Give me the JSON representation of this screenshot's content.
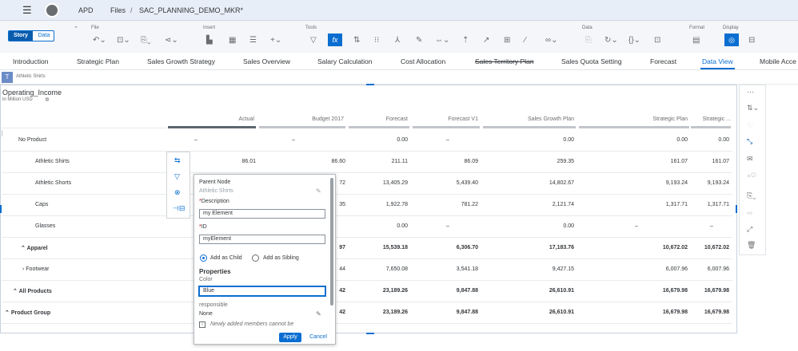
{
  "shell": {
    "menu_icon": "hamburger-icon",
    "app": "APD",
    "breadcrumb_root": "Files",
    "breadcrumb_sep": "/",
    "file_name": "SAC_PLANNING_DEMO_MKR*"
  },
  "toolbar": {
    "modes": [
      "Story",
      "Data"
    ],
    "active_mode": "Story",
    "groups": {
      "file": "File",
      "insert": "Insert",
      "tools": "Tools",
      "data": "Data",
      "format": "Format",
      "display": "Display"
    }
  },
  "tabs": [
    {
      "label": "Introduction"
    },
    {
      "label": "Strategic Plan"
    },
    {
      "label": "Sales Growth Strategy"
    },
    {
      "label": "Sales Overview"
    },
    {
      "label": "Salary Calculation"
    },
    {
      "label": "Cost Allocation"
    },
    {
      "label": "Sales Territory Plan"
    },
    {
      "label": "Sales Quota Setting"
    },
    {
      "label": "Forecast"
    },
    {
      "label": "Data View"
    },
    {
      "label": "Mobile Acce"
    }
  ],
  "filter_chip": {
    "icon": "T",
    "label": "Athletic Shirts"
  },
  "table": {
    "title": "Operating_Income",
    "subtitle": "in Million USD",
    "columns": [
      "Actual",
      "Budget 2017",
      "Forecast",
      "Forecast V1",
      "Sales Growth Plan",
      "Strategic Plan",
      "Strategic ..."
    ],
    "rows": [
      {
        "label": "No Product",
        "values": [
          "–",
          "–",
          "0.00",
          "–",
          "0.00",
          "0.00",
          "0.00"
        ]
      },
      {
        "label": "Athletic Shirts",
        "values": [
          "86.01",
          "86.60",
          "211.11",
          "86.09",
          "259.35",
          "161.07",
          "161.07"
        ]
      },
      {
        "label": "Athletic Shorts",
        "values": [
          "",
          "72",
          "13,405.29",
          "5,439.40",
          "14,802.67",
          "9,193.24",
          "9,193.24"
        ]
      },
      {
        "label": "Caps",
        "values": [
          "",
          "35",
          "1,922.78",
          "781.22",
          "2,121.74",
          "1,317.71",
          "1,317.71"
        ]
      },
      {
        "label": "Glasses",
        "values": [
          "",
          "",
          "0.00",
          "–",
          "0.00",
          "–",
          "–"
        ]
      },
      {
        "label": "Apparel",
        "values": [
          "",
          "97",
          "15,539.18",
          "6,306.70",
          "17,183.76",
          "10,672.02",
          "10,672.02"
        ]
      },
      {
        "label": "Footwear",
        "values": [
          "",
          "44",
          "7,650.08",
          "3,541.18",
          "9,427.15",
          "6,007.96",
          "6,007.96"
        ]
      },
      {
        "label": "All Products",
        "values": [
          "",
          "42",
          "23,189.26",
          "9,847.88",
          "26,610.91",
          "16,679.98",
          "16,679.98"
        ]
      },
      {
        "label": "Product Group",
        "values": [
          "",
          "42",
          "23,189.26",
          "9,847.88",
          "26,610.91",
          "16,679.98",
          "16,679.98"
        ]
      }
    ]
  },
  "popup": {
    "parent_node_label": "Parent Node",
    "parent_node_value": "Athletic Shirts",
    "description_label": "Description",
    "description_value": "my Element",
    "id_label": "ID",
    "id_value": "myElement",
    "add_as_child": "Add as Child",
    "add_as_sibling": "Add as Sibling",
    "properties_title": "Properties",
    "color_label": "Color",
    "color_value": "Blue",
    "responsible_label": "responsible",
    "responsible_value": "None",
    "info_text": "Newly added members cannot be",
    "apply": "Apply",
    "cancel": "Cancel"
  },
  "colors": {
    "accent": "#0a6ed1",
    "shell": "#e8eef7"
  }
}
